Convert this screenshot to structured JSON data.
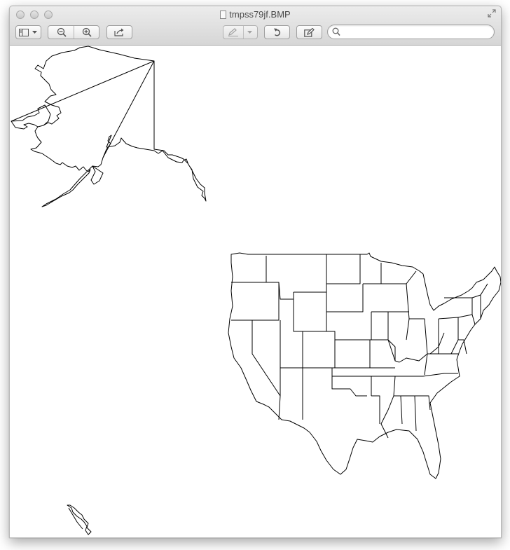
{
  "window": {
    "title": "tmpss79jf.BMP"
  },
  "toolbar": {
    "buttons": [
      {
        "name": "sidebar-toggle-button",
        "icon": "sidebar-icon"
      },
      {
        "name": "zoom-out-button",
        "icon": "zoom-out-icon"
      },
      {
        "name": "zoom-in-button",
        "icon": "zoom-in-icon"
      },
      {
        "name": "share-button",
        "icon": "share-icon"
      },
      {
        "name": "markup-pen-button",
        "icon": "pen-icon"
      },
      {
        "name": "rotate-button",
        "icon": "rotate-icon"
      },
      {
        "name": "annotate-button",
        "icon": "edit-box-icon"
      }
    ],
    "search": {
      "placeholder": "",
      "value": ""
    }
  },
  "document": {
    "content": "map-outline-alaska-contiguous-states-hawaii"
  },
  "colors": {
    "titlebar_top": "#ececec",
    "titlebar_bottom": "#d6d6d6",
    "line": "#000000",
    "background": "#ffffff"
  }
}
